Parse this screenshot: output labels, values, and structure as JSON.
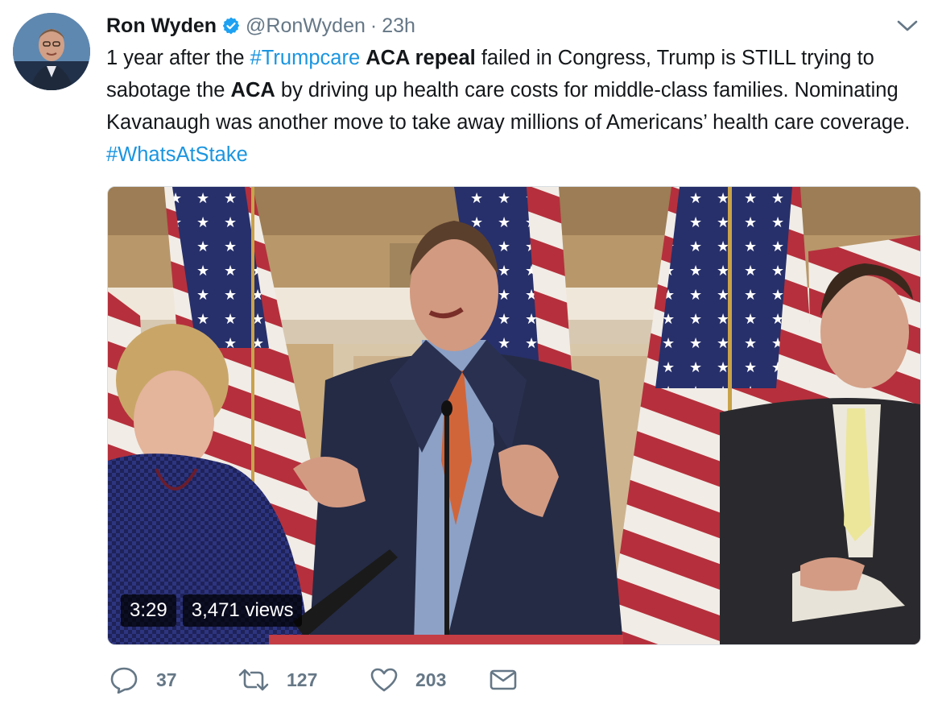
{
  "author": {
    "name": "Ron Wyden",
    "handle": "@RonWyden",
    "separator": "·",
    "time": "23h"
  },
  "tweet": {
    "segments": [
      {
        "text": "1 year after the ",
        "style": "plain"
      },
      {
        "text": "#Trumpcare",
        "style": "hashtag"
      },
      {
        "text": " ",
        "style": "plain"
      },
      {
        "text": "ACA repeal",
        "style": "bold"
      },
      {
        "text": " failed in Congress, Trump is STILL trying to sabotage the ",
        "style": "plain"
      },
      {
        "text": "ACA",
        "style": "bold"
      },
      {
        "text": " by driving up health care costs for middle-class families. Nominating Kavanaugh was another move to take away millions of Americans’ health care coverage. ",
        "style": "plain"
      },
      {
        "text": "#WhatsAtStake",
        "style": "hashtag"
      }
    ]
  },
  "video": {
    "duration": "3:29",
    "views": "3,471 views"
  },
  "actions": {
    "replies": "37",
    "retweets": "127",
    "likes": "203"
  },
  "icons": {
    "verified": "verified-badge-icon",
    "caret": "chevron-down-icon",
    "reply": "reply-icon",
    "retweet": "retweet-icon",
    "like": "heart-icon",
    "dm": "envelope-icon"
  },
  "colors": {
    "hashtag": "#1b95e0",
    "verified": "#1da1f2",
    "secondary_text": "#657786",
    "primary_text": "#14171a"
  }
}
